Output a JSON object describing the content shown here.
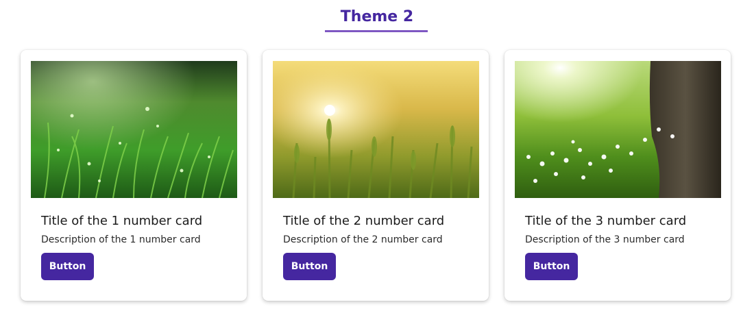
{
  "header": {
    "title": "Theme 2"
  },
  "colors": {
    "accent": "#4527a0",
    "underline": "#7e57c2"
  },
  "cards": [
    {
      "title": "Title of the 1 number card",
      "description": "Description of the 1 number card",
      "button_label": "Button",
      "image": "grass-dew-photo"
    },
    {
      "title": "Title of the 2 number card",
      "description": "Description of the 2 number card",
      "button_label": "Button",
      "image": "wheat-field-sunset-photo"
    },
    {
      "title": "Title of the 3 number card",
      "description": "Description of the 3 number card",
      "button_label": "Button",
      "image": "meadow-tree-flowers-photo"
    }
  ]
}
